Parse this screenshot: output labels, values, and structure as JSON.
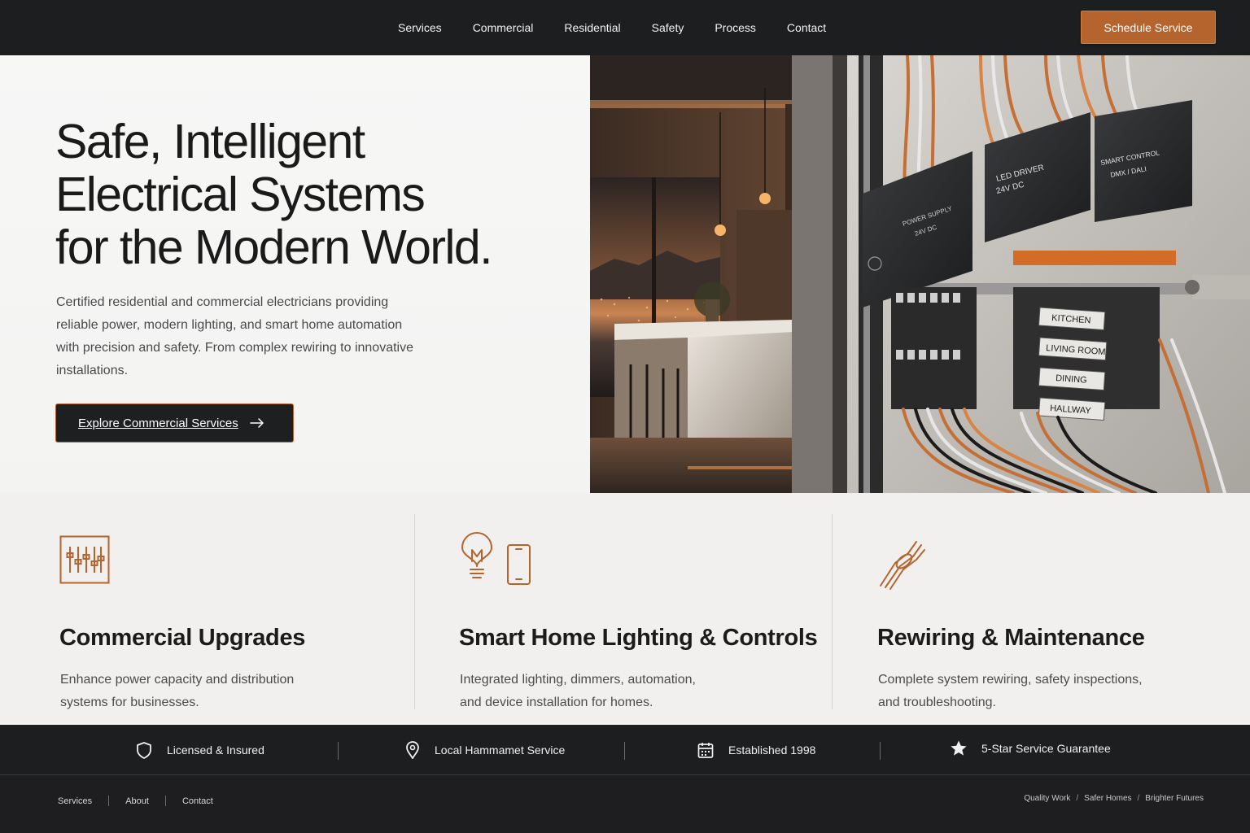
{
  "nav": {
    "items": [
      "Services",
      "Commercial",
      "Residential",
      "Safety",
      "Process",
      "Contact"
    ],
    "cta": "Schedule Service"
  },
  "hero": {
    "title_lines": [
      "Safe, Intelligent",
      "Electrical Systems",
      "for the Modern World."
    ],
    "description": "Certified residential and commercial electricians providing reliable power, modern lighting, and smart home automation with precision and safety. From complex rewiring to innovative installations.",
    "button": "Explore Commercial Services",
    "panel_labels": {
      "power_supply": "POWER SUPPLY",
      "power_supply_v": "24V DC",
      "led_driver": "LED DRIVER",
      "led_driver_v": "24V DC",
      "smart_control": "SMART CONTROL",
      "smart_control_sub": "DMX / DALI",
      "circuits": [
        "KITCHEN",
        "LIVING ROOM",
        "DINING",
        "HALLWAY"
      ]
    }
  },
  "services": [
    {
      "icon": "control-panel-icon",
      "title": "Commercial Upgrades",
      "desc_lines": [
        "Enhance power capacity and distribution",
        "systems for businesses."
      ]
    },
    {
      "icon": "lightbulb-phone-icon",
      "title": "Smart Home Lighting & Controls",
      "desc_lines": [
        "Integrated lighting, dimmers, automation,",
        "and device installation for homes."
      ]
    },
    {
      "icon": "wire-icon",
      "title": "Rewiring & Maintenance",
      "desc_lines": [
        "Complete system rewiring, safety inspections,",
        "and troubleshooting."
      ]
    }
  ],
  "trust": [
    {
      "icon": "shield-icon",
      "label": "Licensed & Insured"
    },
    {
      "icon": "location-pin-icon",
      "label": "Local Hammamet Service"
    },
    {
      "icon": "calendar-icon",
      "label": "Established 1998"
    },
    {
      "icon": "star-icon",
      "label": "5-Star Service Guarantee"
    }
  ],
  "footer": {
    "links": [
      "Services",
      "About",
      "Contact"
    ],
    "tagline": [
      "Quality Work",
      "Safer Homes",
      "Brighter Futures"
    ]
  },
  "colors": {
    "accent": "#b5642d",
    "dark": "#1d1e20",
    "light": "#f1f0ef"
  }
}
